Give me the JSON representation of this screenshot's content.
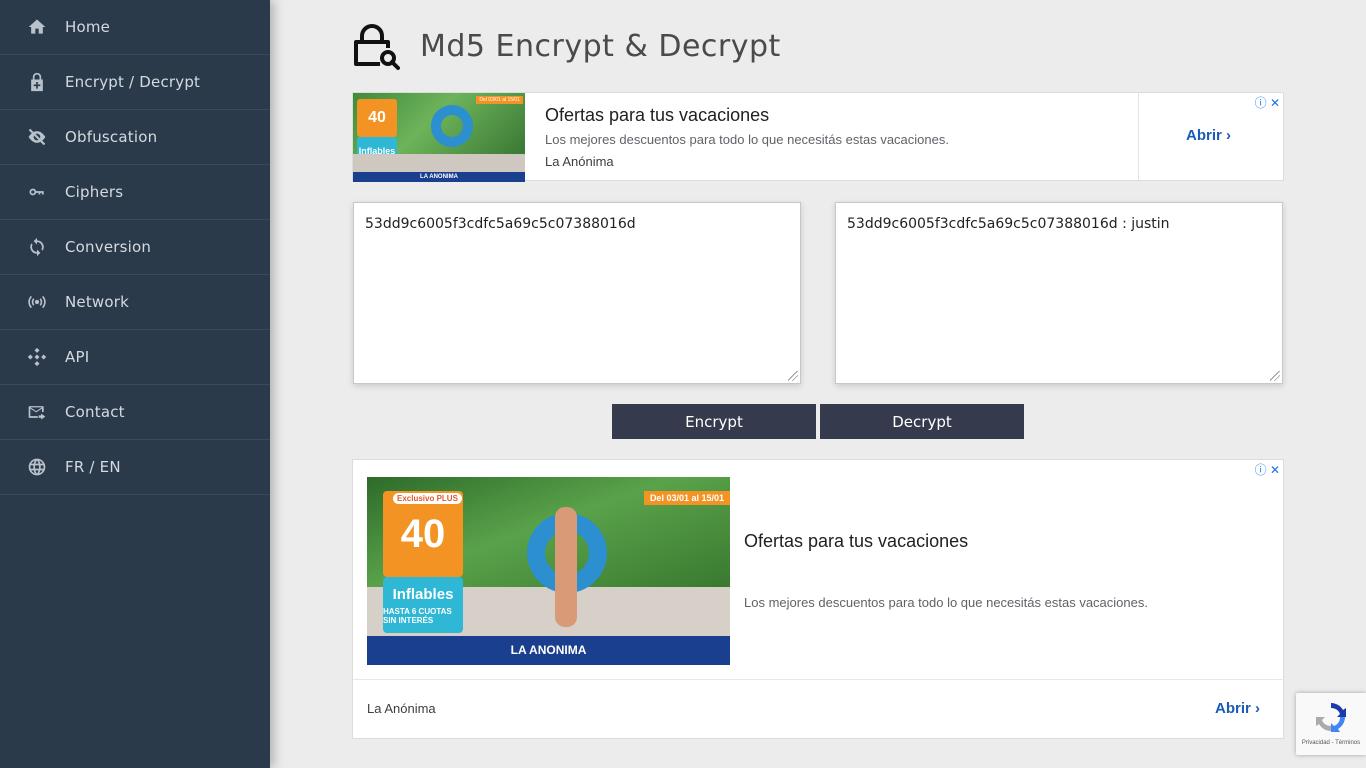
{
  "sidebar": {
    "items": [
      {
        "label": "Home",
        "icon": "home-icon"
      },
      {
        "label": "Encrypt / Decrypt",
        "icon": "lock-plus-icon"
      },
      {
        "label": "Obfuscation",
        "icon": "eye-off-icon"
      },
      {
        "label": "Ciphers",
        "icon": "key-icon"
      },
      {
        "label": "Conversion",
        "icon": "refresh-icon"
      },
      {
        "label": "Network",
        "icon": "broadcast-icon"
      },
      {
        "label": "API",
        "icon": "api-icon"
      },
      {
        "label": "Contact",
        "icon": "mail-icon"
      },
      {
        "label": "FR / EN",
        "icon": "globe-icon"
      }
    ]
  },
  "header": {
    "title": "Md5 Encrypt & Decrypt",
    "icon": "lock-search-icon"
  },
  "ad_top": {
    "title": "Ofertas para tus vacaciones",
    "description": "Los mejores descuentos para todo lo que necesitás estas vacaciones.",
    "brand": "La Anónima",
    "cta": "Abrir",
    "image_badge": "40",
    "image_tag": "Inflables",
    "image_banner": "LA ANONIMA",
    "image_date": "Del 03/01 al 15/01"
  },
  "input": {
    "value": "53dd9c6005f3cdfc5a69c5c07388016d"
  },
  "output": {
    "value": "53dd9c6005f3cdfc5a69c5c07388016d : justin"
  },
  "buttons": {
    "encrypt": "Encrypt",
    "decrypt": "Decrypt"
  },
  "ad_bottom": {
    "title": "Ofertas para tus vacaciones",
    "description": "Los mejores descuentos para todo lo que necesitás estas vacaciones.",
    "brand": "La Anónima",
    "cta": "Abrir",
    "image_exclusive": "Exclusivo PLUS",
    "image_badge": "40",
    "image_tag": "Inflables",
    "image_tag_sub": "HASTA 6 CUOTAS SIN INTERÉS",
    "image_banner": "LA ANONIMA",
    "image_date": "Del 03/01 al 15/01"
  },
  "recaptcha": {
    "text": "Privacidad - Términos"
  },
  "colors": {
    "sidebar_bg": "#2b3a4a",
    "button_bg": "#363a4d",
    "link": "#1a5bb8"
  }
}
